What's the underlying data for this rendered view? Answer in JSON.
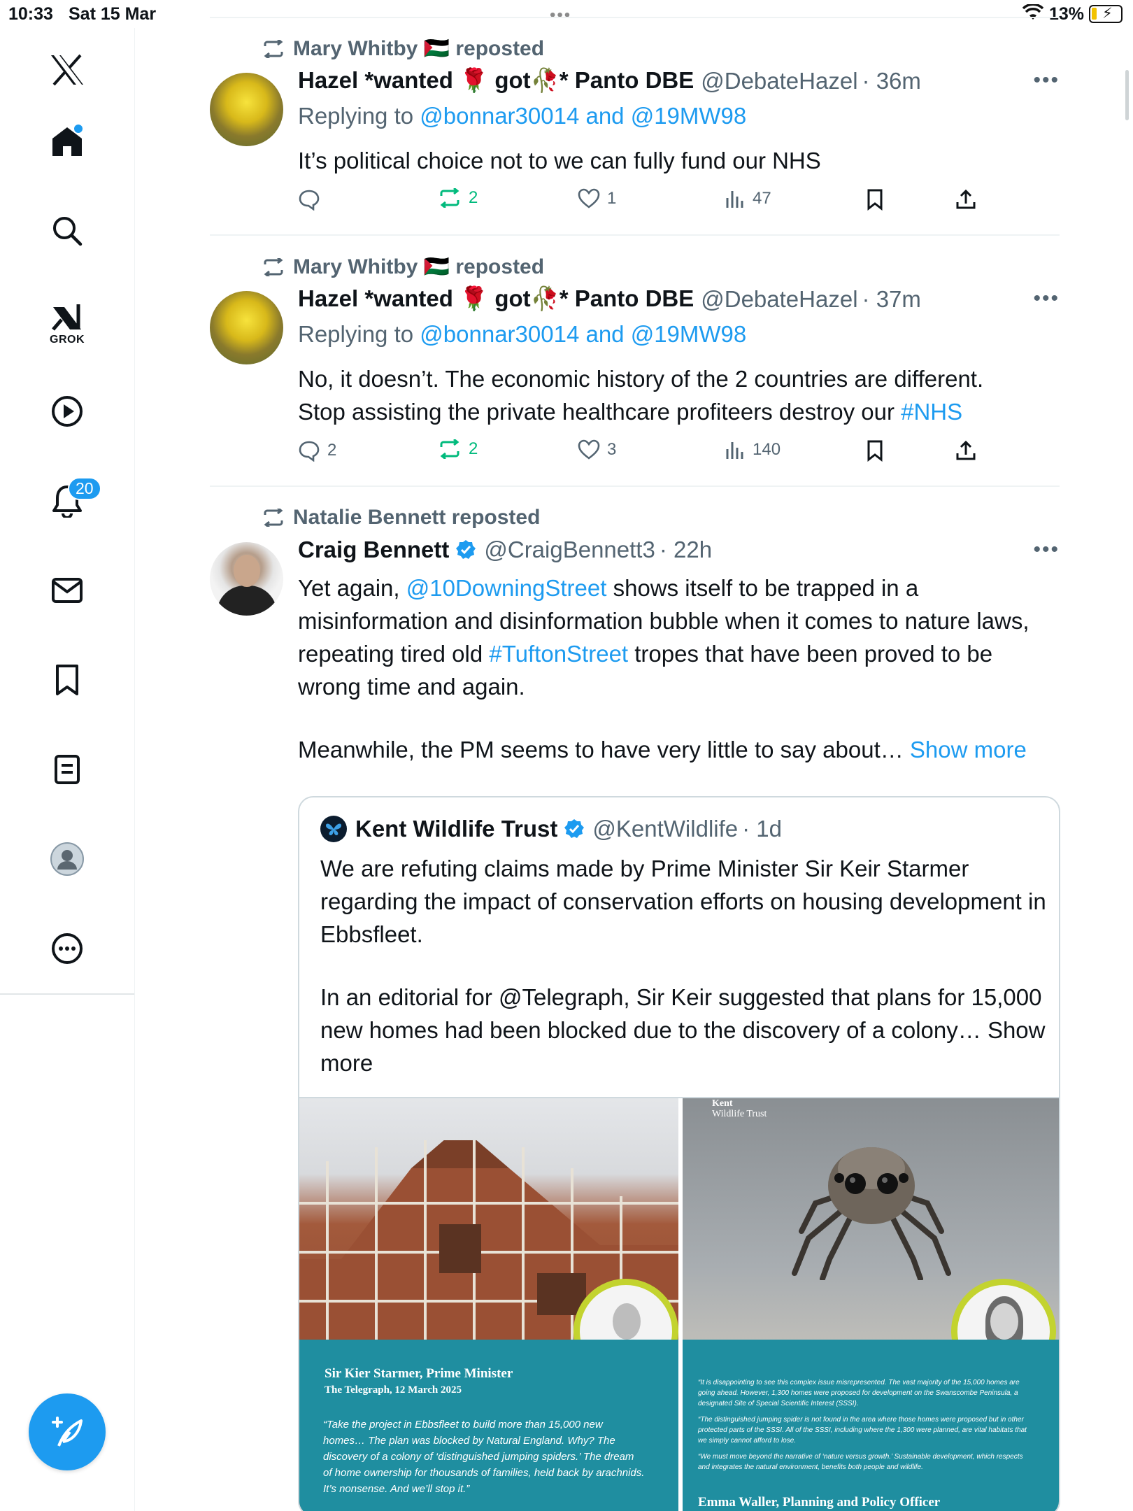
{
  "status_bar": {
    "time": "10:33",
    "date": "Sat 15 Mar",
    "battery": "13%"
  },
  "sidebar": {
    "items": [
      {
        "name": "x-logo"
      },
      {
        "name": "home"
      },
      {
        "name": "search"
      },
      {
        "name": "grok",
        "label": "GROK"
      },
      {
        "name": "video"
      },
      {
        "name": "notifications",
        "badge": "20"
      },
      {
        "name": "messages"
      },
      {
        "name": "bookmarks"
      },
      {
        "name": "lists"
      },
      {
        "name": "profile"
      },
      {
        "name": "more"
      }
    ]
  },
  "colors": {
    "accent": "#1d9bf0",
    "text": "#0f1419",
    "muted": "#536471",
    "repost_green": "#00ba7c",
    "divider": "#eff3f4"
  },
  "posts": [
    {
      "reposted_by": "Mary Whitby 🇵🇸 reposted",
      "name": "Hazel *wanted 🌹 got🥀* Panto DBE",
      "handle": "@DebateHazel",
      "time": "· 36m",
      "replying_prefix": "Replying to",
      "replying_users": "@bonnar30014 and @19MW98",
      "text": "It’s political choice not to we can fully fund our NHS",
      "replies": "",
      "reposts": "2",
      "likes": "1",
      "views": "47"
    },
    {
      "reposted_by": "Mary Whitby 🇵🇸 reposted",
      "name": "Hazel *wanted 🌹 got🥀* Panto DBE",
      "handle": "@DebateHazel",
      "time": "· 37m",
      "replying_prefix": "Replying to",
      "replying_users": "@bonnar30014 and @19MW98",
      "text_line1": "No, it doesn’t. The economic history of the 2 countries are different.",
      "text_line2_prefix": "Stop assisting the private healthcare profiteers destroy our ",
      "text_line2_tag": "#NHS",
      "replies": "2",
      "reposts": "2",
      "likes": "3",
      "views": "140"
    },
    {
      "reposted_by": "Natalie Bennett reposted",
      "name": "Craig Bennett",
      "handle": "@CraigBennett3",
      "time": "· 22h",
      "text_a": "Yet again, ",
      "mention": "@10DowningStreet",
      "text_b": " shows itself to be trapped in a misinformation and disinformation bubble when it comes to nature laws, repeating tired old ",
      "hashtag": "#TuftonStreet",
      "text_c": " tropes that have been proved to be wrong time and again.",
      "text_d": "Meanwhile, the PM seems to have very little to say about…",
      "show_more": "Show more",
      "quote": {
        "name": "Kent Wildlife Trust",
        "handle": "@KentWildlife",
        "time": "· 1d",
        "para1": "We are refuting claims made by Prime Minister Sir Keir Starmer regarding the impact of conservation efforts on housing development in Ebbsfleet.",
        "para2": "In an editorial for @Telegraph, Sir Keir suggested that plans for 15,000 new homes had been blocked due to the discovery of a colony…",
        "show_more": "Show more",
        "image_left": {
          "title": "Sir Kier Starmer, Prime Minister",
          "subtitle": "The Telegraph, 12 March 2025",
          "quote": "“Take the project in Ebbsfleet to build more than 15,000 new homes… The plan was blocked by Natural England. Why? The discovery of a colony of ‘distinguished jumping spiders.’ The dream of home ownership for thousands of families, held back by arachnids. It’s nonsense. And we’ll stop it.”"
        },
        "image_right": {
          "logo_line1": "Kent",
          "logo_line2": "Wildlife Trust",
          "quote1": "“It is disappointing to see this complex issue misrepresented. The vast majority of the 15,000 homes are going ahead. However, 1,300 homes were proposed for development on the Swanscombe Peninsula, a designated Site of Special Scientific Interest (SSSI).",
          "quote2": "“The distinguished jumping spider is not found in the area where those homes were proposed but in other protected parts of the SSSI. All of the SSSI, including where the 1,300 were planned, are vital habitats that we simply cannot afford to lose.",
          "quote3": "“We must move beyond the narrative of ‘nature versus growth.’ Sustainable development, which respects and integrates the natural environment, benefits both people and wildlife.",
          "signature": "Emma Waller, Planning and Policy Officer"
        }
      }
    }
  ]
}
